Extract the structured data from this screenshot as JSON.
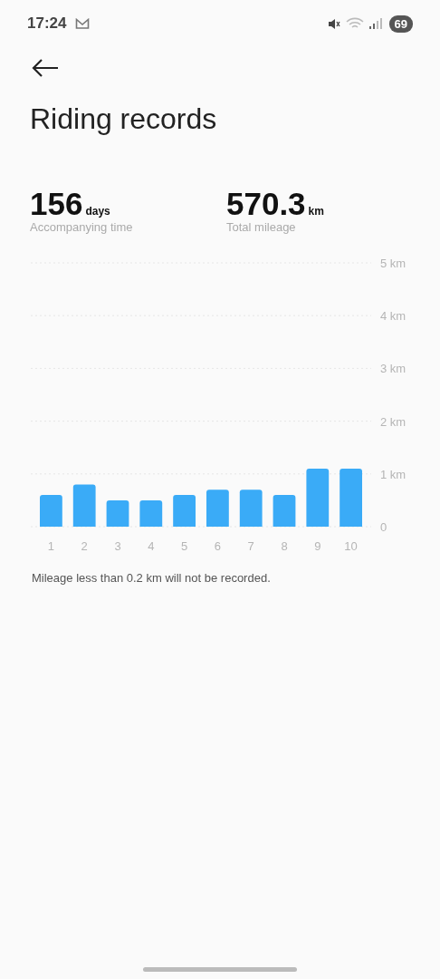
{
  "status_bar": {
    "time": "17:24",
    "battery": "69"
  },
  "title": "Riding records",
  "stats": [
    {
      "value": "156",
      "unit": "days",
      "label": "Accompanying time"
    },
    {
      "value": "570.3",
      "unit": "km",
      "label": "Total mileage"
    }
  ],
  "chart_data": {
    "type": "bar",
    "categories": [
      "1",
      "2",
      "3",
      "4",
      "5",
      "6",
      "7",
      "8",
      "9",
      "10"
    ],
    "values": [
      0.6,
      0.8,
      0.5,
      0.5,
      0.6,
      0.7,
      0.7,
      0.6,
      1.1,
      1.1
    ],
    "grid": true,
    "ylim": [
      0,
      5
    ],
    "yticks": [
      {
        "value": 0,
        "label": "0"
      },
      {
        "value": 1,
        "label": "1 km"
      },
      {
        "value": 2,
        "label": "2 km"
      },
      {
        "value": 3,
        "label": "3 km"
      },
      {
        "value": 4,
        "label": "4 km"
      },
      {
        "value": 5,
        "label": "5 km"
      }
    ]
  },
  "note": "Mileage less than 0.2 km will not be recorded."
}
